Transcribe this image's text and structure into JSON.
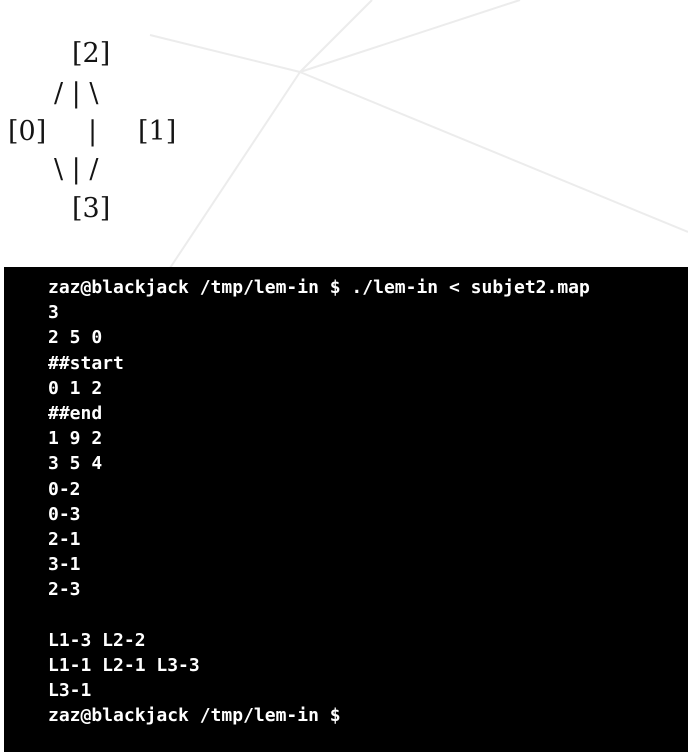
{
  "graph": {
    "line_1": "[2]",
    "line_2": "/ | \\",
    "line_3_left": "[0]",
    "line_3_mid": "|",
    "line_3_right": "[1]",
    "line_4": "\\ | /",
    "line_5": "[3]"
  },
  "terminal": {
    "lines": [
      "zaz@blackjack /tmp/lem-in $ ./lem-in < subjet2.map",
      "3",
      "2 5 0",
      "##start",
      "0 1 2",
      "##end",
      "1 9 2",
      "3 5 4",
      "0-2",
      "0-3",
      "2-1",
      "3-1",
      "2-3",
      "",
      "L1-3 L2-2",
      "L1-1 L2-1 L3-3",
      "L3-1",
      "zaz@blackjack /tmp/lem-in $"
    ]
  },
  "colors": {
    "terminal_background": "#000000",
    "terminal_text": "#ffffff",
    "diagram_text": "#141414"
  }
}
